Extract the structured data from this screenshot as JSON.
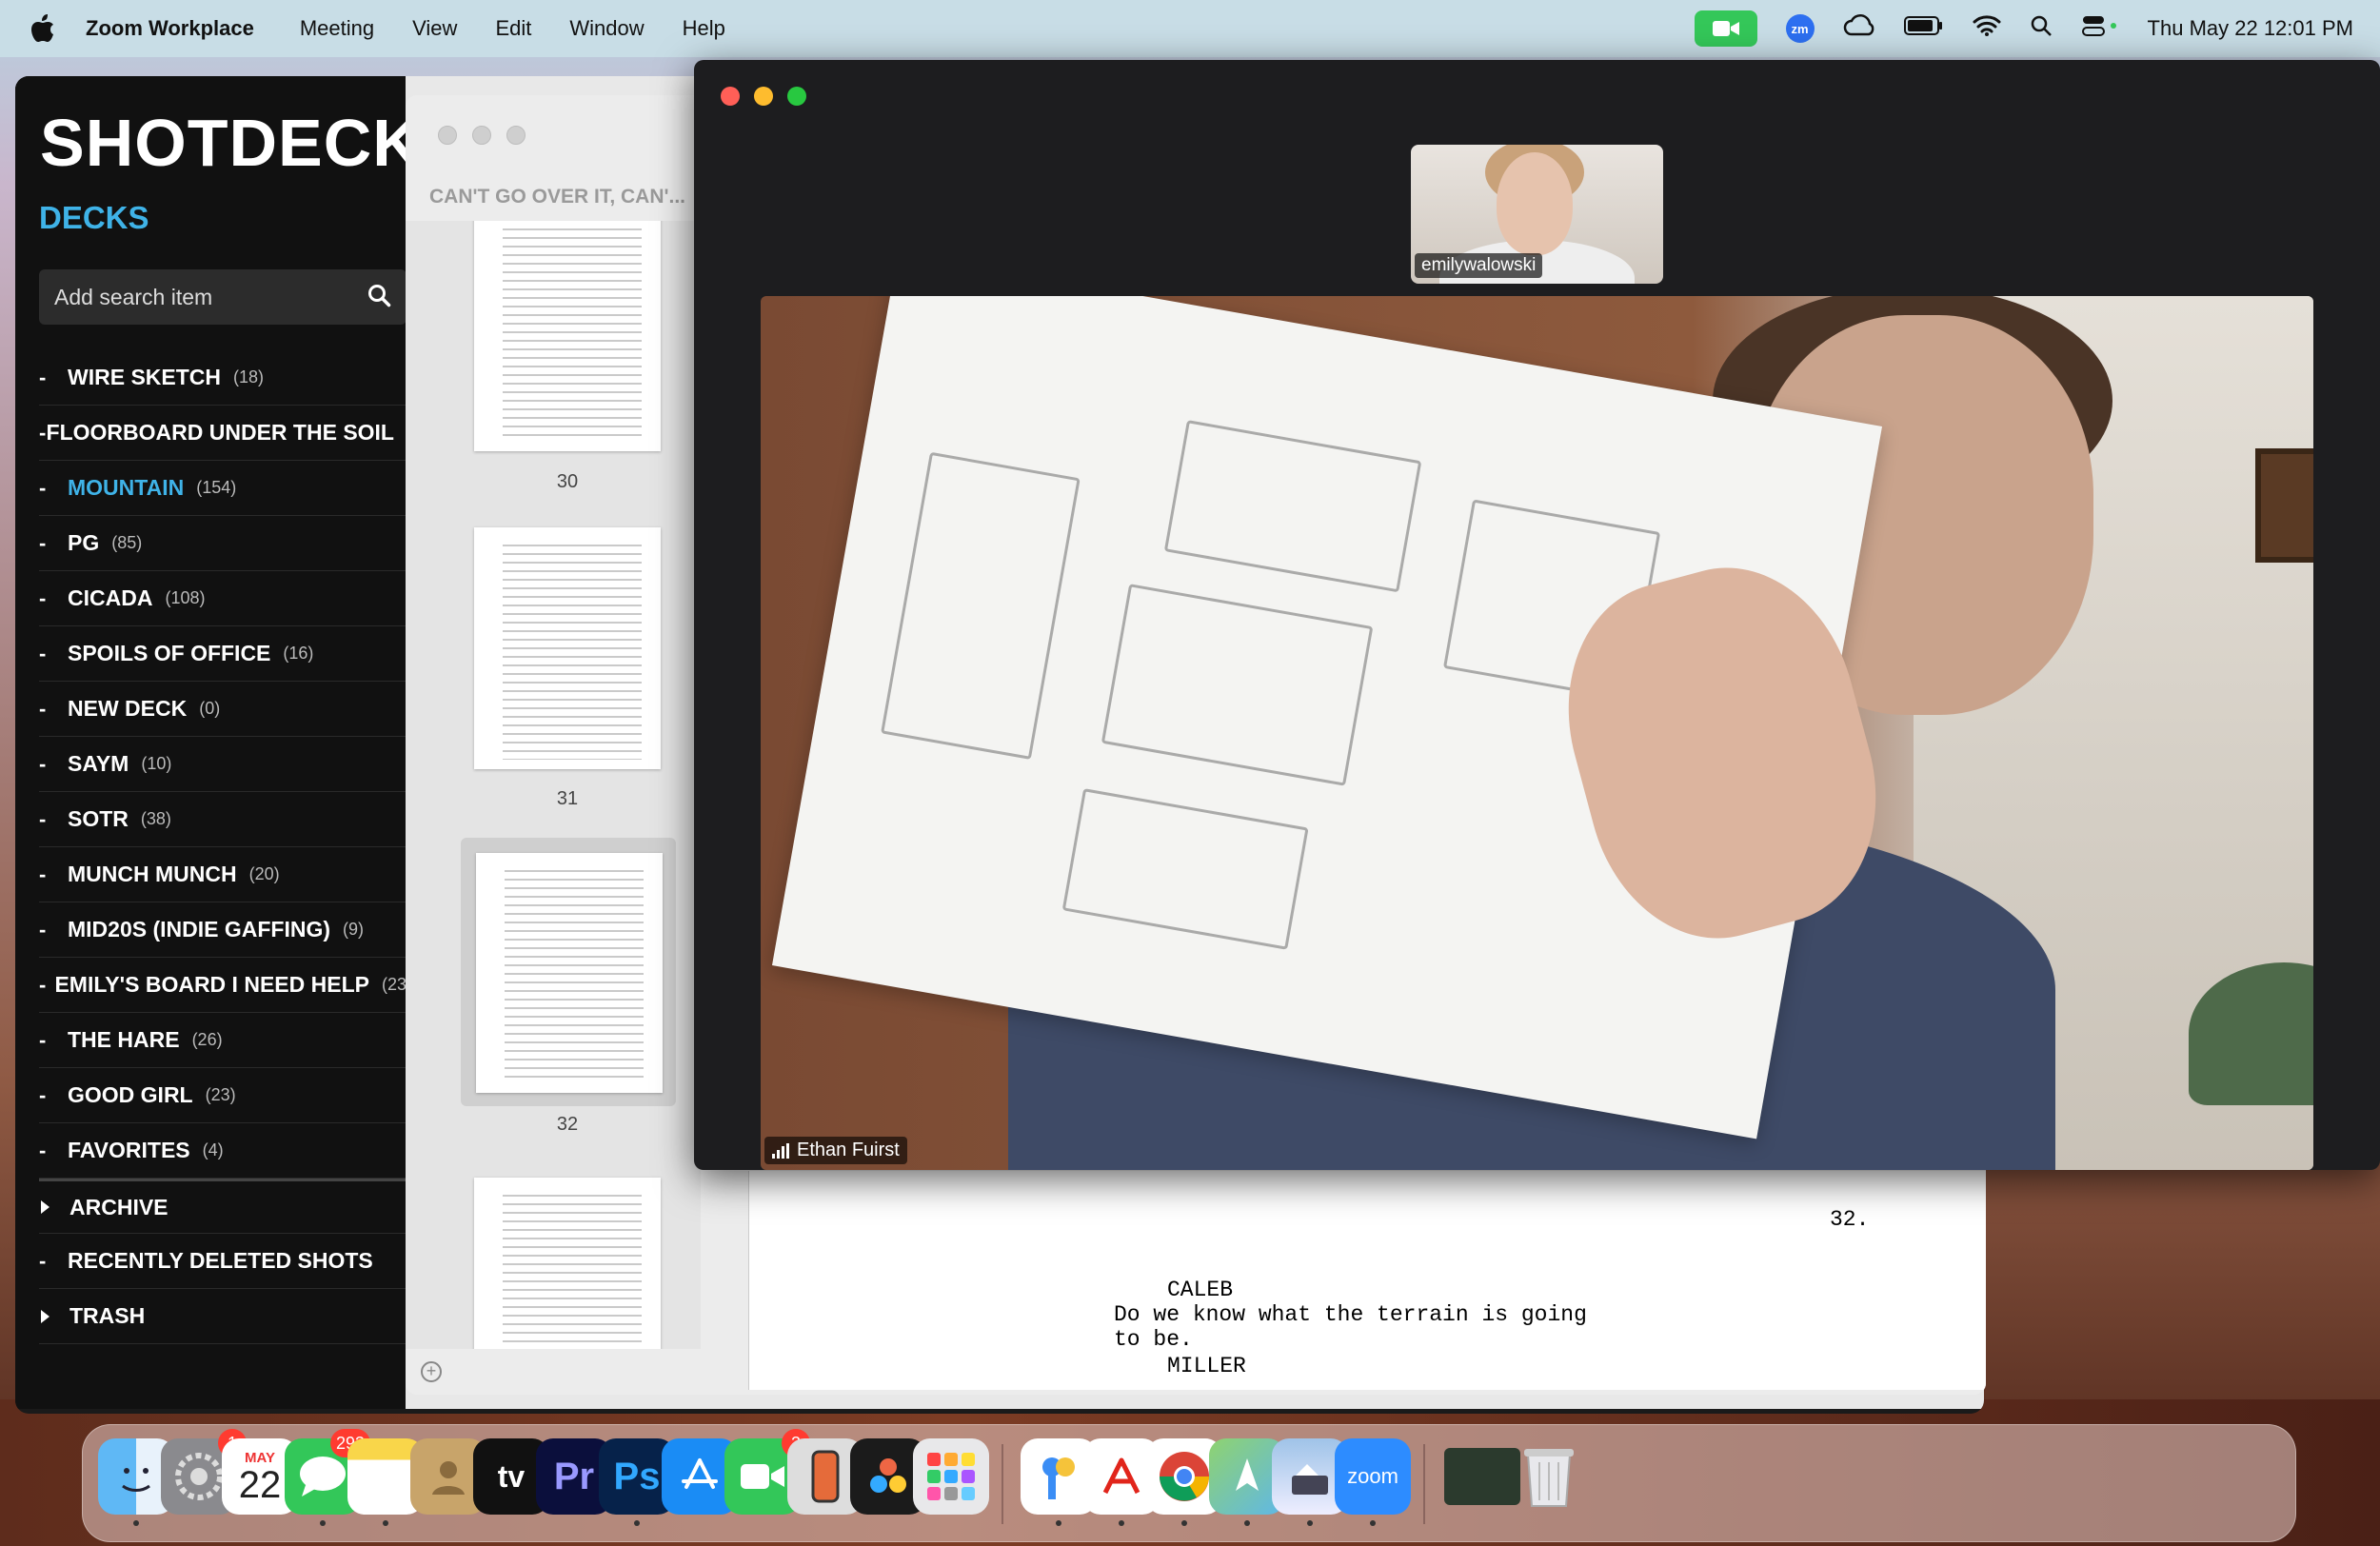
{
  "menubar": {
    "app": "Zoom Workplace",
    "items": [
      "Meeting",
      "View",
      "Edit",
      "Window",
      "Help"
    ],
    "clock": "Thu May 22  12:01 PM",
    "zm_label": "zm"
  },
  "shotdeck": {
    "logo": "SHOTDECK",
    "logo_mark": "®",
    "decks_heading": "DECKS",
    "search_placeholder": "Add search item",
    "decks": [
      {
        "name": "WIRE SKETCH",
        "count": "(18)"
      },
      {
        "name": "FLOORBOARD UNDER THE SOIL",
        "count": ""
      },
      {
        "name": "MOUNTAIN",
        "count": "(154)",
        "active": true
      },
      {
        "name": "PG",
        "count": "(85)"
      },
      {
        "name": "CICADA",
        "count": "(108)"
      },
      {
        "name": "SPOILS OF OFFICE",
        "count": "(16)"
      },
      {
        "name": "NEW DECK",
        "count": "(0)"
      },
      {
        "name": "SAYM",
        "count": "(10)"
      },
      {
        "name": "SOTR",
        "count": "(38)"
      },
      {
        "name": "MUNCH MUNCH",
        "count": "(20)"
      },
      {
        "name": "MID20S (INDIE GAFFING)",
        "count": "(9)"
      },
      {
        "name": "EMILY'S BOARD I NEED HELP",
        "count": "(23"
      },
      {
        "name": "THE HARE",
        "count": "(26)"
      },
      {
        "name": "GOOD GIRL",
        "count": "(23)"
      },
      {
        "name": "FAVORITES",
        "count": "(4)"
      }
    ],
    "archive_items": [
      {
        "name": "ARCHIVE",
        "marker": "triangle"
      },
      {
        "name": "RECENTLY DELETED SHOTS",
        "marker": "dash"
      },
      {
        "name": "TRASH",
        "marker": "triangle"
      }
    ]
  },
  "preview": {
    "title": "CAN'T GO OVER IT, CAN'...",
    "pages": [
      "30",
      "31",
      "32"
    ],
    "selected_page": "32",
    "page_number": "32.",
    "character1": "CALEB",
    "dialogue": "Do we know what the terrain is going to be.",
    "character2": "MILLER"
  },
  "zoom": {
    "self_name": "emilywalowski",
    "speaker_name": "Ethan Fuirst",
    "colors": {
      "close": "#ff5f57",
      "minimize": "#febc2e",
      "zoom": "#28c840"
    }
  },
  "dock": {
    "calendar_month": "MAY",
    "calendar_day": "22",
    "badges": {
      "settings": "1",
      "messages": "293",
      "facetime": "2"
    },
    "labels": {
      "tv": "tv",
      "premiere": "Pr",
      "photoshop": "Ps",
      "zoom": "zoom"
    }
  }
}
